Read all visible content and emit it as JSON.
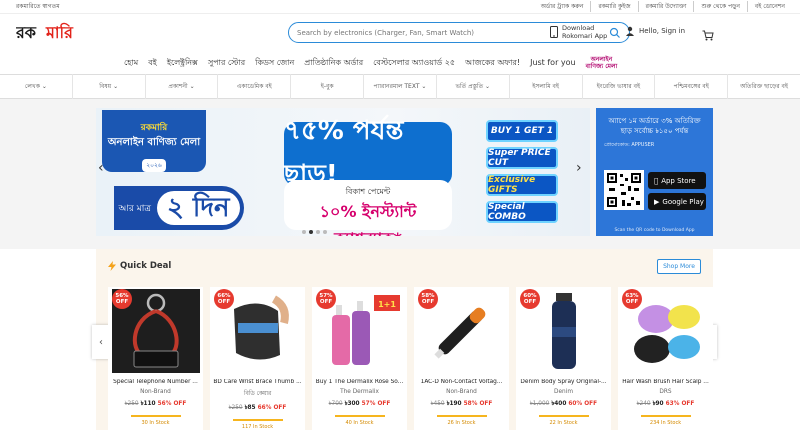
{
  "topbar": {
    "left": "রকমারিতে স্বাগতম",
    "links": [
      "অর্ডার ট্র্যাক করুন",
      "রকমারি কুইজ",
      "রকমারি উদ্যোক্তা",
      "শুরু থেকে পড়ুন",
      "বই ডোনেশন"
    ]
  },
  "header": {
    "logo_text": "রকমারি",
    "search_placeholder": "Search by electronics (Charger, Fan, Smart Watch)",
    "download_l1": "Download",
    "download_l2": "Rokomari App",
    "signin_l1": "Hello, Sign in"
  },
  "mainnav": [
    "হোম",
    "বই",
    "ইলেক্ট্রনিক্স",
    "সুপার স্টোর",
    "কিডস জোন",
    "প্রাতিষ্ঠানিক অর্ডার",
    "বেস্টসেলার অ্যাওয়ার্ড ২৫",
    "আজকের অফার!",
    "Just for you"
  ],
  "mela_tag": {
    "l1": "অনলাইন",
    "l2": "বাণিজ্য মেলা"
  },
  "catnav": [
    "লেখক ⌄",
    "বিষয় ⌄",
    "প্রকাশনী ⌄",
    "একাডেমিক বই",
    "ই-বুক",
    "প্যারানরমাল TEXT ⌄",
    "ভর্তি প্রস্তুতি ⌄",
    "ইসলামি বই",
    "ইংরেজি ভাষার বই",
    "পশ্চিমবঙ্গের বই",
    "অতিরিক্ত ছাড়ের বই"
  ],
  "banner": {
    "mela_l1": "রকমারি",
    "mela_l2": "অনলাইন বাণিজ্য মেলা",
    "mela_l3": "২০২৬",
    "days_small": "আর মাত্র",
    "days_big": "২ দিন",
    "off": "৭৫% পর্যন্ত ছাড়!",
    "cash_l1": "বিকাশ পেমেন্ট",
    "cash_l2": "১০% ইনস্ট্যান্ট ক্যাশব্যাক*",
    "tags": [
      "BUY 1 GET 1",
      "Super PRICE CUT",
      "Exclusive GIFTS",
      "Special COMBO"
    ]
  },
  "apppanel": {
    "offer": "অ্যাপে ১ম অর্ডারে ৩% অতিরিক্ত ছাড় সর্বোচ্চ ৳১৫০ পর্যন্ত",
    "promo": "প্রোমোকোড: APPUSER",
    "appstore": "App Store",
    "playstore": "Google Play",
    "scan": "Scan the QR code to Download App"
  },
  "quickdeal": {
    "title": "Quick Deal",
    "shop_more": "Shop More",
    "items": [
      {
        "badge": "56% OFF",
        "name": "Special Telephone Number ...",
        "author": "Non-Brand",
        "old": "৳250",
        "price": "৳110",
        "off": "56% OFF",
        "stock": "30 In Stock"
      },
      {
        "badge": "66% OFF",
        "name": "BD Care Wrist Brace Thumb ...",
        "author": "বিডি কেয়ার",
        "old": "৳250",
        "price": "৳85",
        "off": "66% OFF",
        "stock": "117 In Stock"
      },
      {
        "badge": "57% OFF",
        "name": "Buy 1 The Dermalix Rose So...",
        "author": "The Dermalix",
        "old": "৳700",
        "price": "৳300",
        "off": "57% OFF",
        "stock": "40 In Stock"
      },
      {
        "badge": "58% OFF",
        "name": "1AC-D Non-Contact Voltag...",
        "author": "Non-Brand",
        "old": "৳450",
        "price": "৳190",
        "off": "58% OFF",
        "stock": "26 In Stock"
      },
      {
        "badge": "60% OFF",
        "name": "Denim Body Spray Original-...",
        "author": "Denim",
        "old": "৳1,000",
        "price": "৳400",
        "off": "60% OFF",
        "stock": "22 In Stock"
      },
      {
        "badge": "63% OFF",
        "name": "Hair Wash Brush Hair Scalp ...",
        "author": "DRS",
        "old": "৳240",
        "price": "৳90",
        "off": "63% OFF",
        "stock": "234 In Stock"
      }
    ]
  },
  "colors": {
    "brand_blue": "#2b8bd8",
    "sale_red": "#e63a2f",
    "panel_blue": "#2d76d8"
  }
}
